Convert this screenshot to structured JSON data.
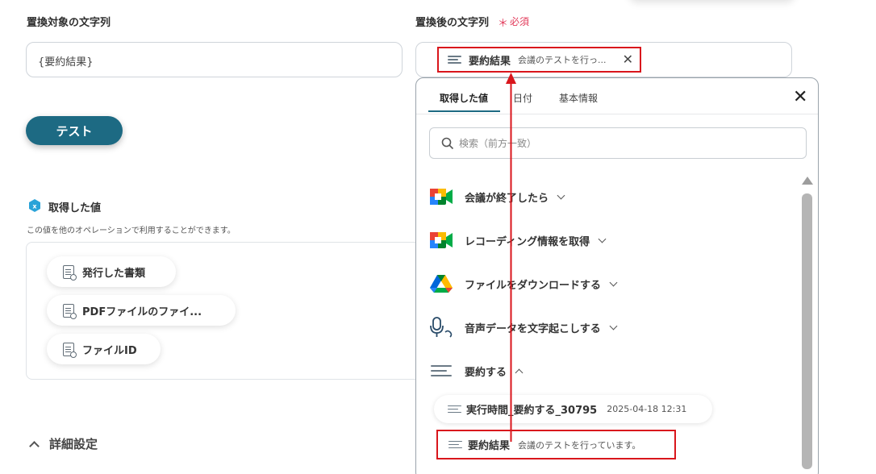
{
  "left": {
    "source_label": "置換対象の文字列",
    "source_value": "{要約結果}",
    "test_button": "テスト",
    "values_title": "取得した値",
    "values_note": "この値を他のオペレーションで利用することができます。",
    "value_chips": [
      {
        "label": "発行した書類"
      },
      {
        "label": "PDFファイルのファイ..."
      },
      {
        "label": "ファイルID"
      }
    ],
    "advanced_label": "詳細設定"
  },
  "right": {
    "target_label": "置換後の文字列",
    "required_mark": "＊",
    "required_label": "必須",
    "selected": {
      "name": "要約結果",
      "preview": "会議のテストを行っ..."
    },
    "dropdown": {
      "tabs": [
        {
          "label": "取得した値",
          "active": true
        },
        {
          "label": "日付",
          "active": false
        },
        {
          "label": "基本情報",
          "active": false
        }
      ],
      "search_placeholder": "検索（前方一致）",
      "groups": [
        {
          "label": "会議が終了したら",
          "icon": "google-meet-icon",
          "expanded": false
        },
        {
          "label": "レコーディング情報を取得",
          "icon": "google-meet-icon",
          "expanded": false
        },
        {
          "label": "ファイルをダウンロードする",
          "icon": "google-drive-icon",
          "expanded": false
        },
        {
          "label": "音声データを文字起こしする",
          "icon": "microphone-icon",
          "expanded": false
        },
        {
          "label": "要約する",
          "icon": "lines-icon",
          "expanded": true
        }
      ],
      "items": [
        {
          "name": "実行時間_要約する_30795",
          "value": "2025-04-18 12:31"
        },
        {
          "name": "要約結果",
          "value": "会議のテストを行っています。"
        }
      ]
    }
  },
  "colors": {
    "accent": "#1d6a83",
    "highlight": "#d9161c",
    "required": "#e23a5a"
  }
}
